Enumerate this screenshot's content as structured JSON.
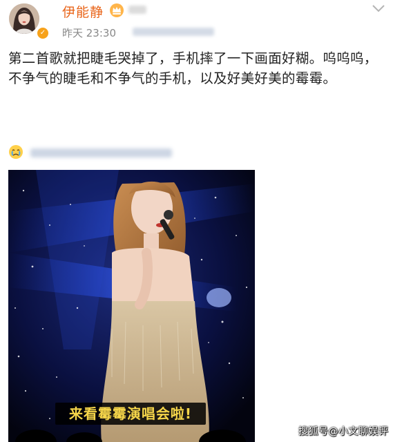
{
  "author": {
    "name": "伊能静",
    "time": "昨天 23:30"
  },
  "post": {
    "text": "第二首歌就把睫毛哭掉了，手机摔了一下画面好糊。呜呜呜，不争气的睫毛和不争气的手机，以及好美好美的霉霉。"
  },
  "media": {
    "caption": "来看霉霉演唱会啦!"
  },
  "watermark": {
    "text": "搜狐号@小文聊娱评"
  },
  "icons": {
    "verified": "verified-badge-icon",
    "member": "member-crown-icon",
    "more": "chevron-down-icon",
    "emoji": "crying-face-icon"
  },
  "colors": {
    "username": "#e9651a",
    "caption": "#f6d64a",
    "verified": "#f7a21b"
  }
}
